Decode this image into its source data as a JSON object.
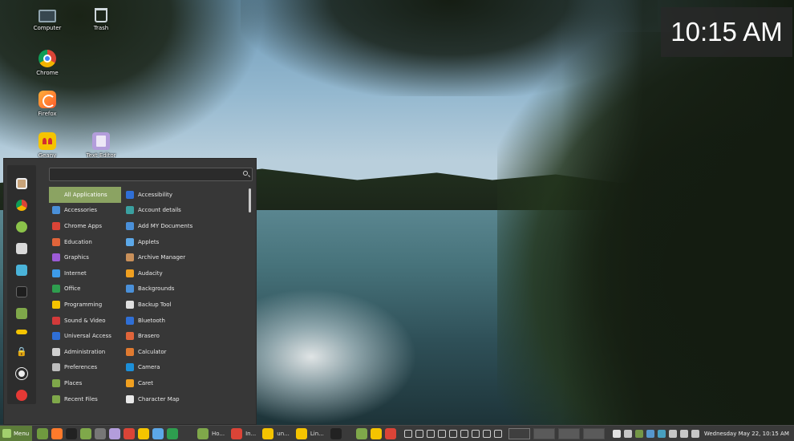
{
  "desktop": {
    "icons": [
      {
        "label": "Computer"
      },
      {
        "label": "Trash"
      },
      {
        "label": "Chrome"
      },
      {
        "label": "Firefox"
      },
      {
        "label": "Geany"
      },
      {
        "label": "Text Editor"
      }
    ]
  },
  "clock": {
    "time": "10:15 AM"
  },
  "menu": {
    "search_placeholder": "",
    "favorites": [
      "app-icon",
      "chrome-icon",
      "green-app-icon",
      "settings-icon",
      "system-icon",
      "terminal-icon",
      "files-icon",
      "geany-icon"
    ],
    "session_buttons": [
      "lock-icon",
      "logout-icon",
      "power-icon"
    ],
    "categories": [
      {
        "label": "All Applications",
        "icon": "grid-icon",
        "color": "#8ba362",
        "active": true
      },
      {
        "label": "Accessories",
        "icon": "accessories-icon",
        "color": "#4a90d9"
      },
      {
        "label": "Chrome Apps",
        "icon": "chrome-icon",
        "color": "#db4437"
      },
      {
        "label": "Education",
        "icon": "education-icon",
        "color": "#e0643a"
      },
      {
        "label": "Graphics",
        "icon": "graphics-icon",
        "color": "#9c5bd6"
      },
      {
        "label": "Internet",
        "icon": "internet-icon",
        "color": "#3d9be9"
      },
      {
        "label": "Office",
        "icon": "office-icon",
        "color": "#2e9e4f"
      },
      {
        "label": "Programming",
        "icon": "programming-icon",
        "color": "#f5c400"
      },
      {
        "label": "Sound & Video",
        "icon": "sound-video-icon",
        "color": "#d33a3a"
      },
      {
        "label": "Universal Access",
        "icon": "universal-access-icon",
        "color": "#2f6fd6"
      },
      {
        "label": "Administration",
        "icon": "administration-icon",
        "color": "#cfcfcf"
      },
      {
        "label": "Preferences",
        "icon": "preferences-icon",
        "color": "#bdbdbd"
      },
      {
        "label": "Places",
        "icon": "folder-icon",
        "color": "#7fa84a"
      },
      {
        "label": "Recent Files",
        "icon": "folder-icon",
        "color": "#7fa84a"
      }
    ],
    "apps": [
      {
        "label": "Accessibility",
        "icon": "accessibility-icon",
        "color": "#2f6fd6"
      },
      {
        "label": "Account details",
        "icon": "account-icon",
        "color": "#3aa0a0"
      },
      {
        "label": "Add MY Documents",
        "icon": "folder-icon",
        "color": "#4a90d9"
      },
      {
        "label": "Applets",
        "icon": "applets-icon",
        "color": "#5ca8e8"
      },
      {
        "label": "Archive Manager",
        "icon": "archive-icon",
        "color": "#c9905a"
      },
      {
        "label": "Audacity",
        "icon": "audacity-icon",
        "color": "#f0a020"
      },
      {
        "label": "Backgrounds",
        "icon": "backgrounds-icon",
        "color": "#4a90d9"
      },
      {
        "label": "Backup Tool",
        "icon": "backup-icon",
        "color": "#e0e0e0"
      },
      {
        "label": "Bluetooth",
        "icon": "bluetooth-icon",
        "color": "#2f6fd6"
      },
      {
        "label": "Brasero",
        "icon": "brasero-icon",
        "color": "#e0643a"
      },
      {
        "label": "Calculator",
        "icon": "calculator-icon",
        "color": "#e07a30"
      },
      {
        "label": "Camera",
        "icon": "camera-icon",
        "color": "#1c8fd8"
      },
      {
        "label": "Caret",
        "icon": "caret-icon",
        "color": "#f0a020"
      },
      {
        "label": "Character Map",
        "icon": "character-map-icon",
        "color": "#e8e8e8"
      }
    ]
  },
  "panel": {
    "menu_label": "Menu",
    "launchers": [
      {
        "name": "show-desktop-icon",
        "color": "#6f9a3f"
      },
      {
        "name": "firefox-icon",
        "color": "#ff7a2b"
      },
      {
        "name": "terminal-icon",
        "color": "#222222"
      },
      {
        "name": "files-icon",
        "color": "#7fa84a"
      },
      {
        "name": "settings-icon",
        "color": "#777777"
      },
      {
        "name": "texteditor-icon",
        "color": "#b39ddb"
      },
      {
        "name": "chrome-icon",
        "color": "#db4437"
      },
      {
        "name": "geany-icon",
        "color": "#f5c400"
      },
      {
        "name": "document-icon",
        "color": "#5ca8e8"
      },
      {
        "name": "spreadsheet-icon",
        "color": "#2e9e4f"
      }
    ],
    "windows": [
      {
        "label": "Ho...",
        "icon": "folder-icon",
        "color": "#7fa84a"
      },
      {
        "label": "In...",
        "icon": "chrome-icon",
        "color": "#db4437"
      },
      {
        "label": "un...",
        "icon": "geany-icon",
        "color": "#f5c400"
      },
      {
        "label": "Lin...",
        "icon": "geany-icon",
        "color": "#f5c400"
      },
      {
        "label": "",
        "icon": "terminal-icon",
        "color": "#222222"
      }
    ],
    "small_launchers": [
      {
        "name": "files-icon",
        "color": "#7fa84a"
      },
      {
        "name": "geany-icon",
        "color": "#f5c400"
      },
      {
        "name": "chrome-icon",
        "color": "#db4437"
      }
    ],
    "tools": [
      {
        "name": "expand-icon",
        "color": "#cfcfcf"
      },
      {
        "name": "grid-icon",
        "color": "#cfcfcf"
      },
      {
        "name": "clock-icon",
        "color": "#cfcfcf"
      },
      {
        "name": "monitor-icon",
        "color": "#cfcfcf"
      },
      {
        "name": "dots-icon",
        "color": "#cfcfcf"
      },
      {
        "name": "screenshot-icon",
        "color": "#cfcfcf"
      },
      {
        "name": "display-icon",
        "color": "#cfcfcf"
      },
      {
        "name": "close-icon",
        "color": "#cfcfcf"
      },
      {
        "name": "undo-icon",
        "color": "#cfcfcf"
      }
    ],
    "workspaces": 4,
    "tray": [
      {
        "name": "update-icon",
        "color": "#ffffff"
      },
      {
        "name": "dropbox-icon",
        "color": "#e0e0e0"
      },
      {
        "name": "shield-icon",
        "color": "#7fa84a"
      },
      {
        "name": "bluetooth-icon",
        "color": "#5ca8e8"
      },
      {
        "name": "app-tray-icon",
        "color": "#4ab3d9"
      },
      {
        "name": "network-icon",
        "color": "#e0e0e0"
      },
      {
        "name": "volume-icon",
        "color": "#e0e0e0"
      },
      {
        "name": "user-icon",
        "color": "#e0e0e0"
      }
    ],
    "datetime": "Wednesday May 22, 10:15 AM"
  }
}
